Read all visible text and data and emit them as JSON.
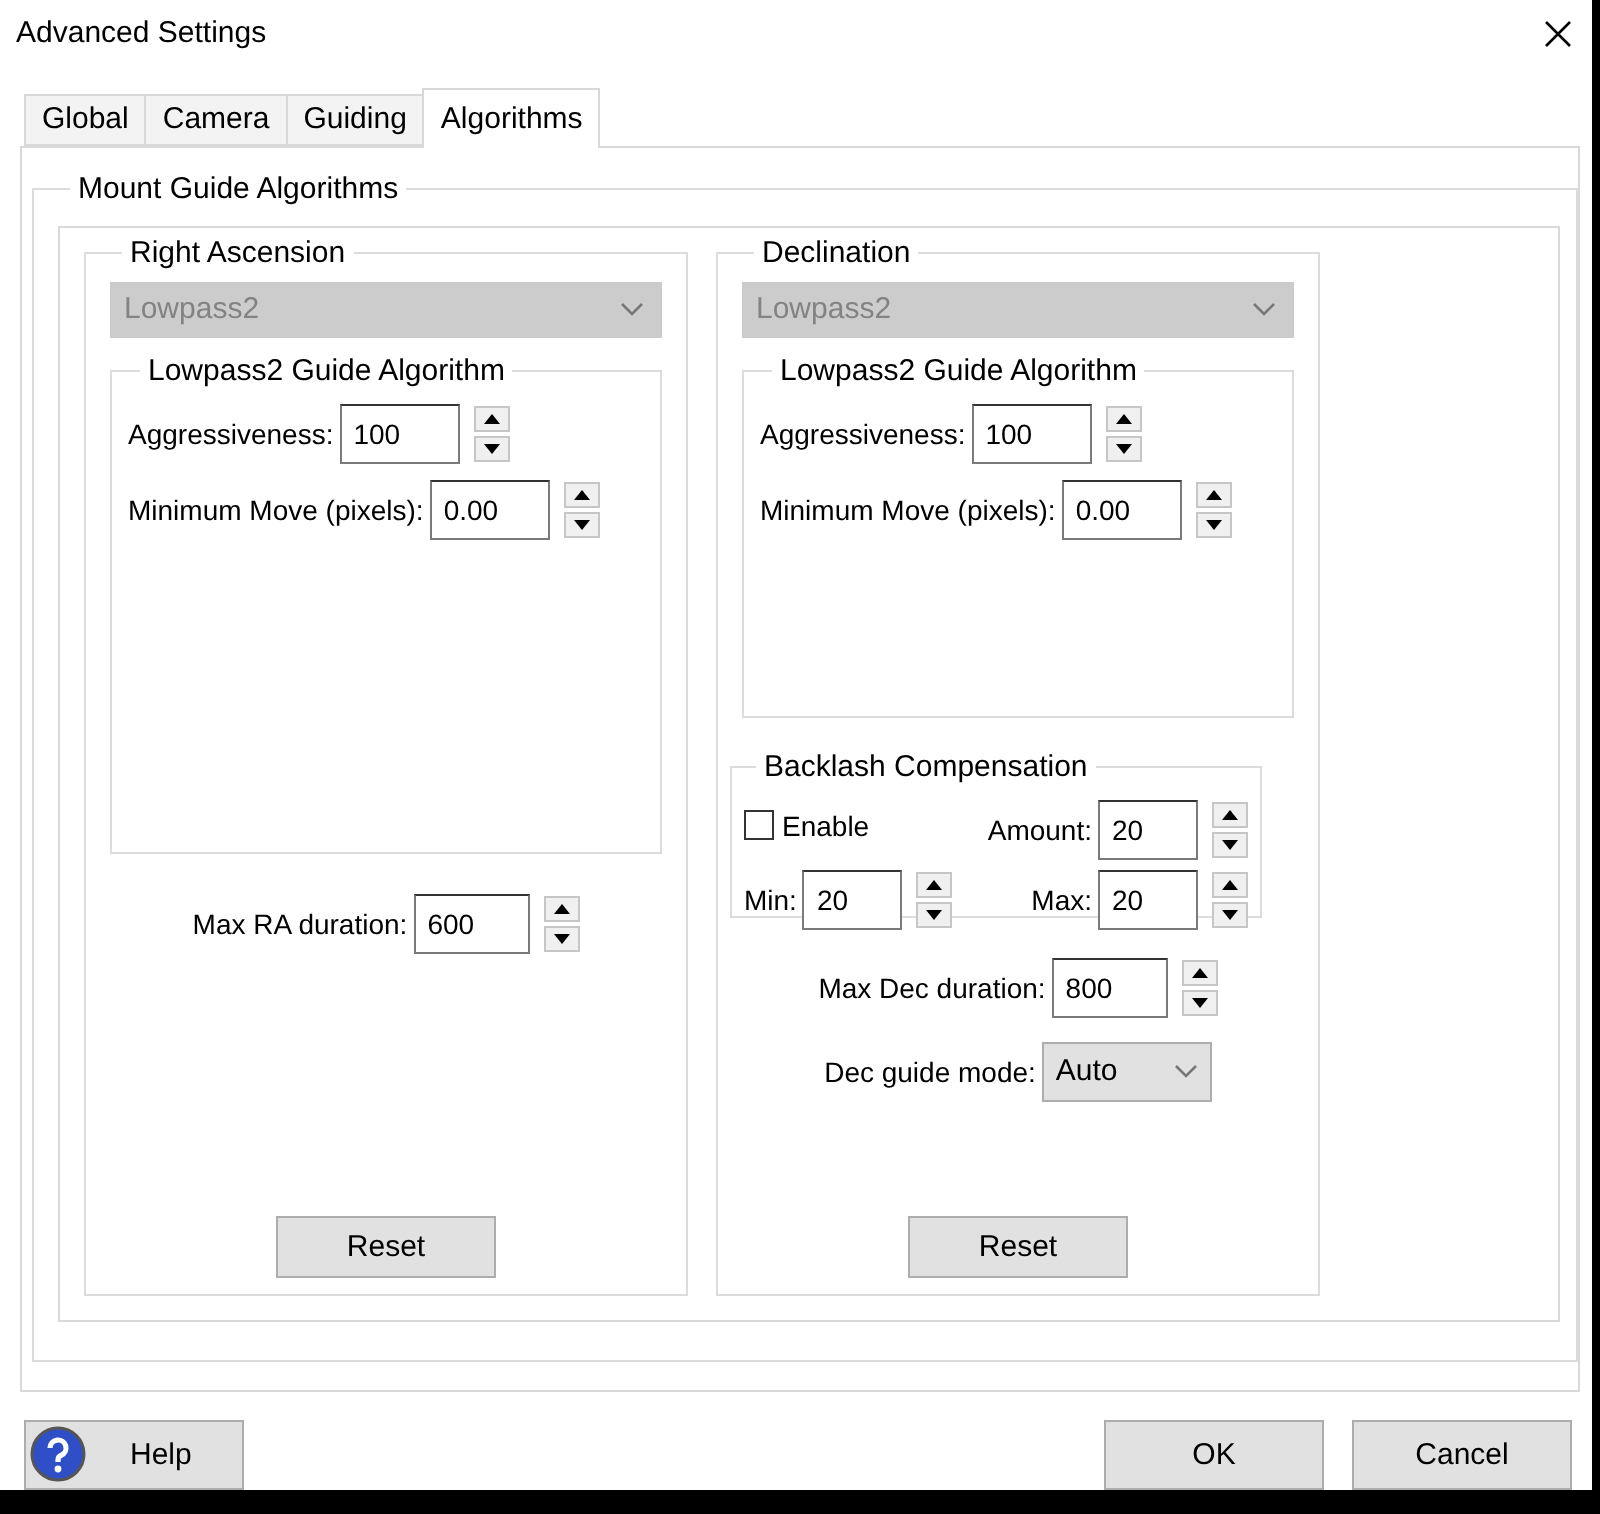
{
  "window": {
    "title": "Advanced Settings"
  },
  "tabs": [
    {
      "label": "Global",
      "selected": false
    },
    {
      "label": "Camera",
      "selected": false
    },
    {
      "label": "Guiding",
      "selected": false
    },
    {
      "label": "Algorithms",
      "selected": true
    }
  ],
  "group_title": "Mount Guide Algorithms",
  "axes": [
    {
      "title": "Right Ascension",
      "algorithm": {
        "value": "Lowpass2",
        "disabled": true
      },
      "algorithm_group": "Lowpass2 Guide Algorithm",
      "params": [
        {
          "label": "Aggressiveness:",
          "value": "100"
        },
        {
          "label": "Minimum Move (pixels):",
          "value": "0.00"
        }
      ],
      "fields": [
        {
          "kind": "spin",
          "label": "Max RA duration:",
          "value": "600"
        }
      ],
      "reset": "Reset"
    },
    {
      "title": "Declination",
      "algorithm": {
        "value": "Lowpass2",
        "disabled": true
      },
      "algorithm_group": "Lowpass2 Guide Algorithm",
      "params": [
        {
          "label": "Aggressiveness:",
          "value": "100"
        },
        {
          "label": "Minimum Move (pixels):",
          "value": "0.00"
        }
      ],
      "backlash": {
        "title": "Backlash Compensation",
        "enable": {
          "label": "Enable",
          "checked": false
        },
        "amount": {
          "label": "Amount:",
          "value": "20"
        },
        "min": {
          "label": "Min:",
          "value": "20"
        },
        "max": {
          "label": "Max:",
          "value": "20"
        }
      },
      "fields": [
        {
          "kind": "spin",
          "label": "Max Dec duration:",
          "value": "800"
        },
        {
          "kind": "select",
          "label": "Dec guide mode:",
          "value": "Auto"
        }
      ],
      "reset": "Reset"
    }
  ],
  "buttons": {
    "help": "Help",
    "ok": "OK",
    "cancel": "Cancel"
  }
}
